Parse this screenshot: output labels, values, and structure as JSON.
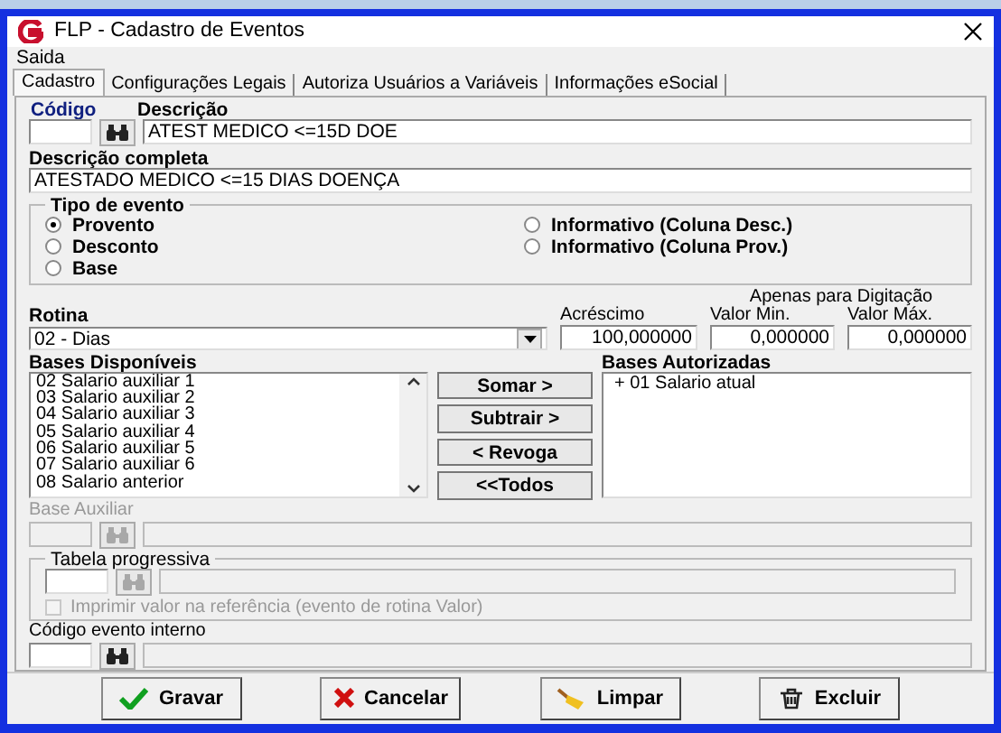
{
  "window": {
    "title": "FLP - Cadastro de Eventos"
  },
  "menu": [
    "Saida"
  ],
  "tabs": [
    {
      "label": "Cadastro",
      "selected": true
    },
    {
      "label": "Configurações Legais",
      "selected": false
    },
    {
      "label": "Autoriza Usuários a Variáveis",
      "selected": false
    },
    {
      "label": "Informações eSocial",
      "selected": false
    }
  ],
  "codigo": {
    "label": "Código"
  },
  "descricao": {
    "label": "Descrição",
    "value": "ATEST MEDICO <=15D DOE"
  },
  "descricao_completa": {
    "label": "Descrição completa",
    "value": "ATESTADO MEDICO <=15 DIAS DOENÇA"
  },
  "tipo_de_evento": {
    "title": "Tipo de evento",
    "options": [
      {
        "label": "Provento",
        "selected": true
      },
      {
        "label": "Desconto",
        "selected": false
      },
      {
        "label": "Base",
        "selected": false
      },
      {
        "label": "Informativo (Coluna Desc.)",
        "selected": false
      },
      {
        "label": "Informativo (Coluna Prov.)",
        "selected": false
      }
    ]
  },
  "rotina": {
    "label": "Rotina",
    "value": "02 - Dias"
  },
  "acrescimo": {
    "label": "Acréscimo",
    "value": "100,000000"
  },
  "digitacao": {
    "caption": "Apenas para Digitação",
    "min_label": "Valor Min.",
    "min_value": "0,000000",
    "max_label": "Valor Máx.",
    "max_value": "0,000000"
  },
  "bases_disponiveis": {
    "label": "Bases Disponíveis",
    "items": [
      "02 Salario auxiliar 1",
      "03 Salario auxiliar 2",
      "04 Salario auxiliar 3",
      "05 Salario auxiliar 4",
      "06 Salario auxiliar 5",
      "07 Salario auxiliar 6",
      "08 Salario anterior"
    ]
  },
  "transfer_buttons": [
    "Somar >",
    "Subtrair >",
    "< Revoga",
    "<<Todos"
  ],
  "bases_autorizadas": {
    "label": "Bases Autorizadas",
    "items": [
      "+ 01 Salario atual"
    ]
  },
  "base_auxiliar": {
    "label": "Base Auxiliar",
    "disabled": true
  },
  "tabela_progressiva": {
    "title": "Tabela progressiva",
    "disabled": true,
    "checkbox": {
      "label": "Imprimir valor na referência (evento de rotina Valor)",
      "checked": false,
      "disabled": true
    }
  },
  "codigo_evento_interno": {
    "label": "Código evento interno",
    "disabled": false
  },
  "buttons": [
    {
      "label": "Gravar",
      "kind": "save"
    },
    {
      "label": "Cancelar",
      "kind": "cancel"
    },
    {
      "label": "Limpar",
      "kind": "clear"
    },
    {
      "label": "Excluir",
      "kind": "delete"
    }
  ]
}
